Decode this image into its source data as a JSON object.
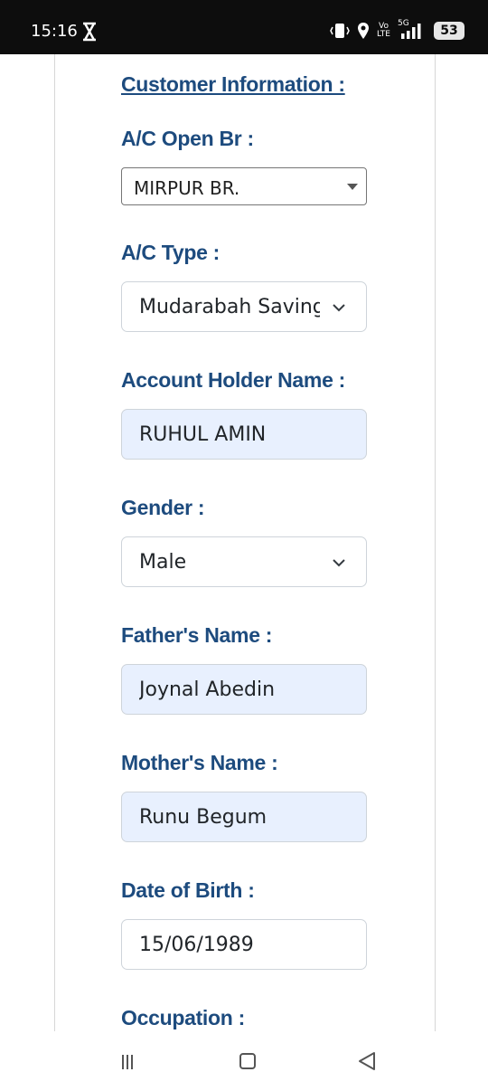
{
  "status_bar": {
    "time": "15:16",
    "volte_top": "Vo",
    "volte_bottom": "LTE",
    "network": "5G",
    "battery": "53"
  },
  "form": {
    "section_title": "Customer Information :",
    "fields": [
      {
        "label": "A/C Open Br :",
        "value": "MIRPUR BR."
      },
      {
        "label": "A/C Type :",
        "value": "Mudarabah Saving"
      },
      {
        "label": "Account Holder Name :",
        "value": "RUHUL AMIN"
      },
      {
        "label": "Gender :",
        "value": "Male"
      },
      {
        "label": "Father's Name :",
        "value": "Joynal Abedin"
      },
      {
        "label": "Mother's Name :",
        "value": "Runu Begum"
      },
      {
        "label": "Date of Birth :",
        "value": "15/06/1989"
      },
      {
        "label": "Occupation :",
        "value": ""
      }
    ]
  },
  "colors": {
    "label": "#1d4b7e",
    "autofill_bg": "#e8f0fe",
    "status_bar_bg": "#0d0d0d"
  }
}
